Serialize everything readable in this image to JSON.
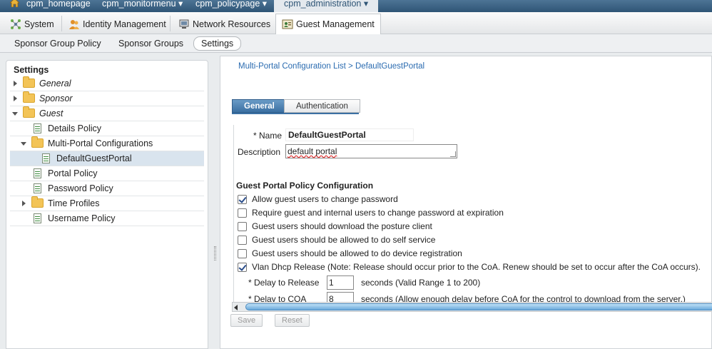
{
  "topnav": {
    "items": [
      "cpm_homepage",
      "cpm_monitormenu ▾",
      "cpm_policypage ▾",
      "cpm_administration ▾"
    ]
  },
  "main_tabs": [
    "System",
    "Identity Management",
    "Network Resources",
    "Guest Management"
  ],
  "sub_tabs": [
    "Sponsor Group Policy",
    "Sponsor Groups",
    "Settings"
  ],
  "sidebar": {
    "title": "Settings",
    "items": [
      {
        "label": "General"
      },
      {
        "label": "Sponsor"
      },
      {
        "label": "Guest"
      },
      {
        "label": "Details Policy"
      },
      {
        "label": "Multi-Portal Configurations"
      },
      {
        "label": "DefaultGuestPortal"
      },
      {
        "label": "Portal Policy"
      },
      {
        "label": "Password Policy"
      },
      {
        "label": "Time Profiles"
      },
      {
        "label": "Username Policy"
      }
    ]
  },
  "breadcrumb": "Multi-Portal Configuration List > DefaultGuestPortal",
  "form_tabs": [
    "General",
    "Authentication"
  ],
  "form": {
    "name_label": "* Name",
    "name_value": "DefaultGuestPortal",
    "desc_label": "Description",
    "desc_value": "default portal",
    "section_title": "Guest Portal Policy Configuration",
    "options": [
      {
        "label": "Allow guest users to change password",
        "checked": true
      },
      {
        "label": "Require guest and internal users to change password at expiration",
        "checked": false
      },
      {
        "label": "Guest users should download the posture client",
        "checked": false
      },
      {
        "label": "Guest users should be allowed to do self service",
        "checked": false
      },
      {
        "label": "Guest users should be allowed to do device registration",
        "checked": false
      },
      {
        "label": "Vlan Dhcp Release (Note: Release should occur prior to the CoA. Renew should be set to occur after the CoA occurs).",
        "checked": true
      }
    ],
    "delay_release_label": "* Delay to Release",
    "delay_release_value": "1",
    "delay_release_hint": "seconds (Valid Range 1 to 200)",
    "delay_coa_label": "* Delay to COA",
    "delay_coa_value": "8",
    "delay_coa_hint": "seconds  (Allow enough delay before CoA for the control to download from the server.)"
  },
  "buttons": {
    "save": "Save",
    "reset": "Reset"
  }
}
